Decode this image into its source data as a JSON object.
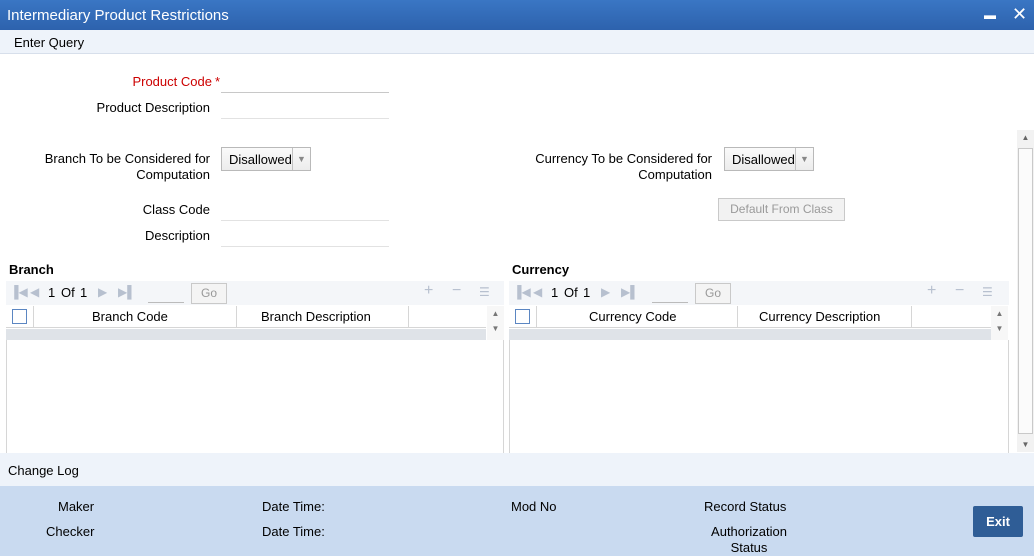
{
  "window": {
    "title": "Intermediary Product Restrictions",
    "minimize": "▬",
    "close": "✕"
  },
  "menu": {
    "enter_query": "Enter Query"
  },
  "form": {
    "product_code_label": "Product Code",
    "required_mark": "*",
    "product_code_value": "",
    "product_description_label": "Product Description",
    "product_description_value": "",
    "branch_label_line1": "Branch To be Considered for",
    "branch_label_line2": "Computation",
    "branch_value": "Disallowed",
    "currency_label_line1": "Currency To be Considered for",
    "currency_label_line2": "Computation",
    "currency_value": "Disallowed",
    "class_code_label": "Class Code",
    "class_code_value": "",
    "description_label": "Description",
    "description_value": "",
    "default_from_class": "Default From Class"
  },
  "branch_grid": {
    "title": "Branch",
    "page_current": "1",
    "page_of": "Of",
    "page_total": "1",
    "go": "Go",
    "columns": [
      "Branch Code",
      "Branch Description"
    ]
  },
  "currency_grid": {
    "title": "Currency",
    "page_current": "1",
    "page_of": "Of",
    "page_total": "1",
    "go": "Go",
    "columns": [
      "Currency Code",
      "Currency Description"
    ]
  },
  "change_log": {
    "title": "Change Log"
  },
  "footer": {
    "maker": "Maker",
    "checker": "Checker",
    "date_time_1": "Date Time:",
    "date_time_2": "Date Time:",
    "mod_no": "Mod No",
    "record_status": "Record Status",
    "auth_status_line1": "Authorization",
    "auth_status_line2": "Status",
    "exit": "Exit"
  },
  "colors": {
    "titlebar": "#2d62ad",
    "footer": "#c9daf0",
    "exit_button": "#2f5d96",
    "required": "#cc0000"
  }
}
